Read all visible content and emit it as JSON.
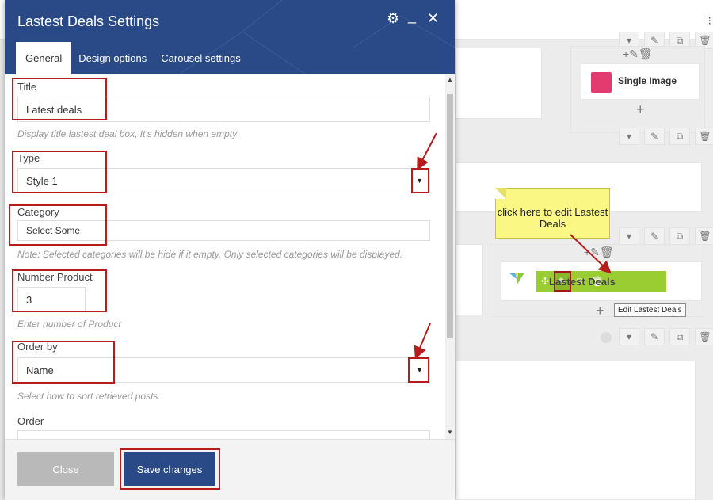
{
  "dialog": {
    "title": "Lastest Deals Settings",
    "controls": {
      "settings_icon": "⚙",
      "minimize_icon": "_",
      "close_icon": "✕"
    },
    "tabs": [
      {
        "label": "General",
        "active": true
      },
      {
        "label": "Design options",
        "active": false
      },
      {
        "label": "Carousel settings",
        "active": false
      }
    ],
    "fields": {
      "title": {
        "label": "Title",
        "value": "Latest deals",
        "help": "Display title lastest deal box, It's hidden when empty"
      },
      "type": {
        "label": "Type",
        "value": "Style 1"
      },
      "category": {
        "label": "Category",
        "placeholder": "Select Some",
        "help": "Note: Selected categories will be hide if it empty. Only selected categories will be displayed."
      },
      "number_product": {
        "label": "Number Product",
        "value": "3",
        "help": "Enter number of Product"
      },
      "order_by": {
        "label": "Order by",
        "value": "Name",
        "help": "Select how to sort retrieved posts."
      },
      "order": {
        "label": "Order",
        "value": ""
      }
    },
    "footer": {
      "close_label": "Close",
      "save_label": "Save changes"
    }
  },
  "background": {
    "single_image_label": "Single Image",
    "element_label": "Lastest Deals",
    "tooltip": "Edit Lastest Deals",
    "callout": "click here to edit Lastest Deals"
  },
  "colors": {
    "header_blue": "#294a86",
    "highlight_red": "#b71c1c",
    "element_green": "#9acd32",
    "callout_yellow": "#fbf784",
    "close_gray": "#b9b9b9"
  }
}
